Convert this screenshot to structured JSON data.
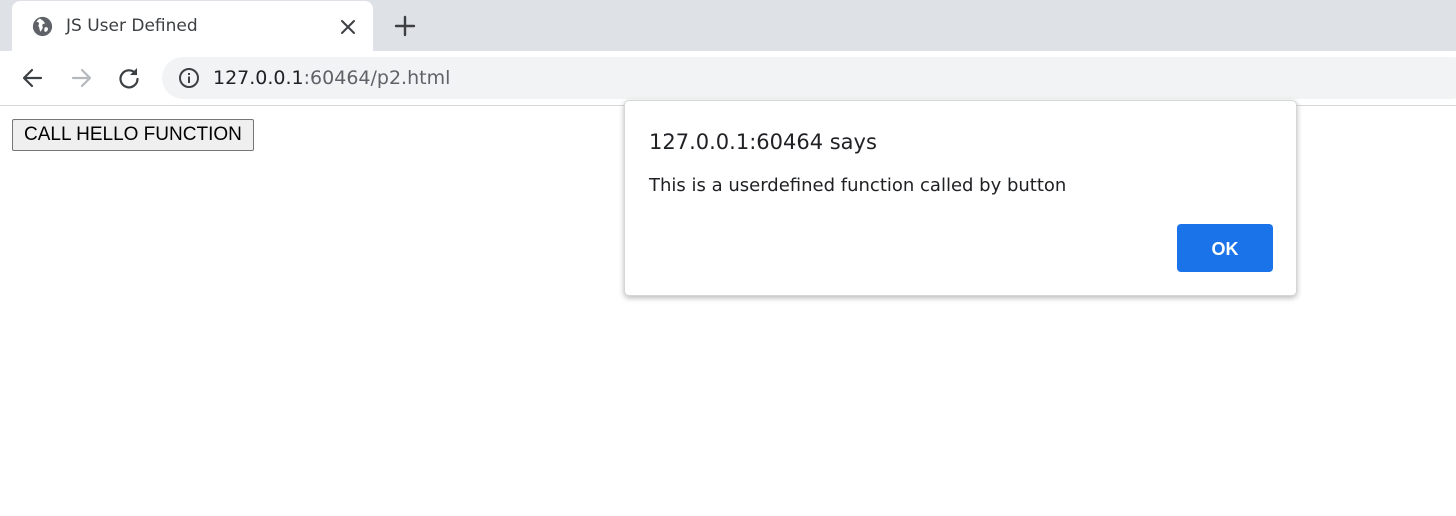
{
  "tab": {
    "title": "JS User Defined",
    "favicon": "globe-icon",
    "close": "close-icon"
  },
  "toolbar": {
    "back": "back-arrow-icon",
    "forward": "forward-arrow-icon",
    "reload": "reload-icon",
    "new_tab": "plus-icon",
    "site_info": "info-icon"
  },
  "address": {
    "host": "127.0.0.1",
    "path": ":60464/p2.html"
  },
  "page": {
    "button_label": "CALL HELLO FUNCTION"
  },
  "dialog": {
    "title": "127.0.0.1:60464 says",
    "message": "This is a userdefined function called by button",
    "ok_label": "OK"
  },
  "colors": {
    "tabstrip": "#dee1e6",
    "omnibox": "#f1f3f4",
    "accent": "#1a73e8"
  }
}
